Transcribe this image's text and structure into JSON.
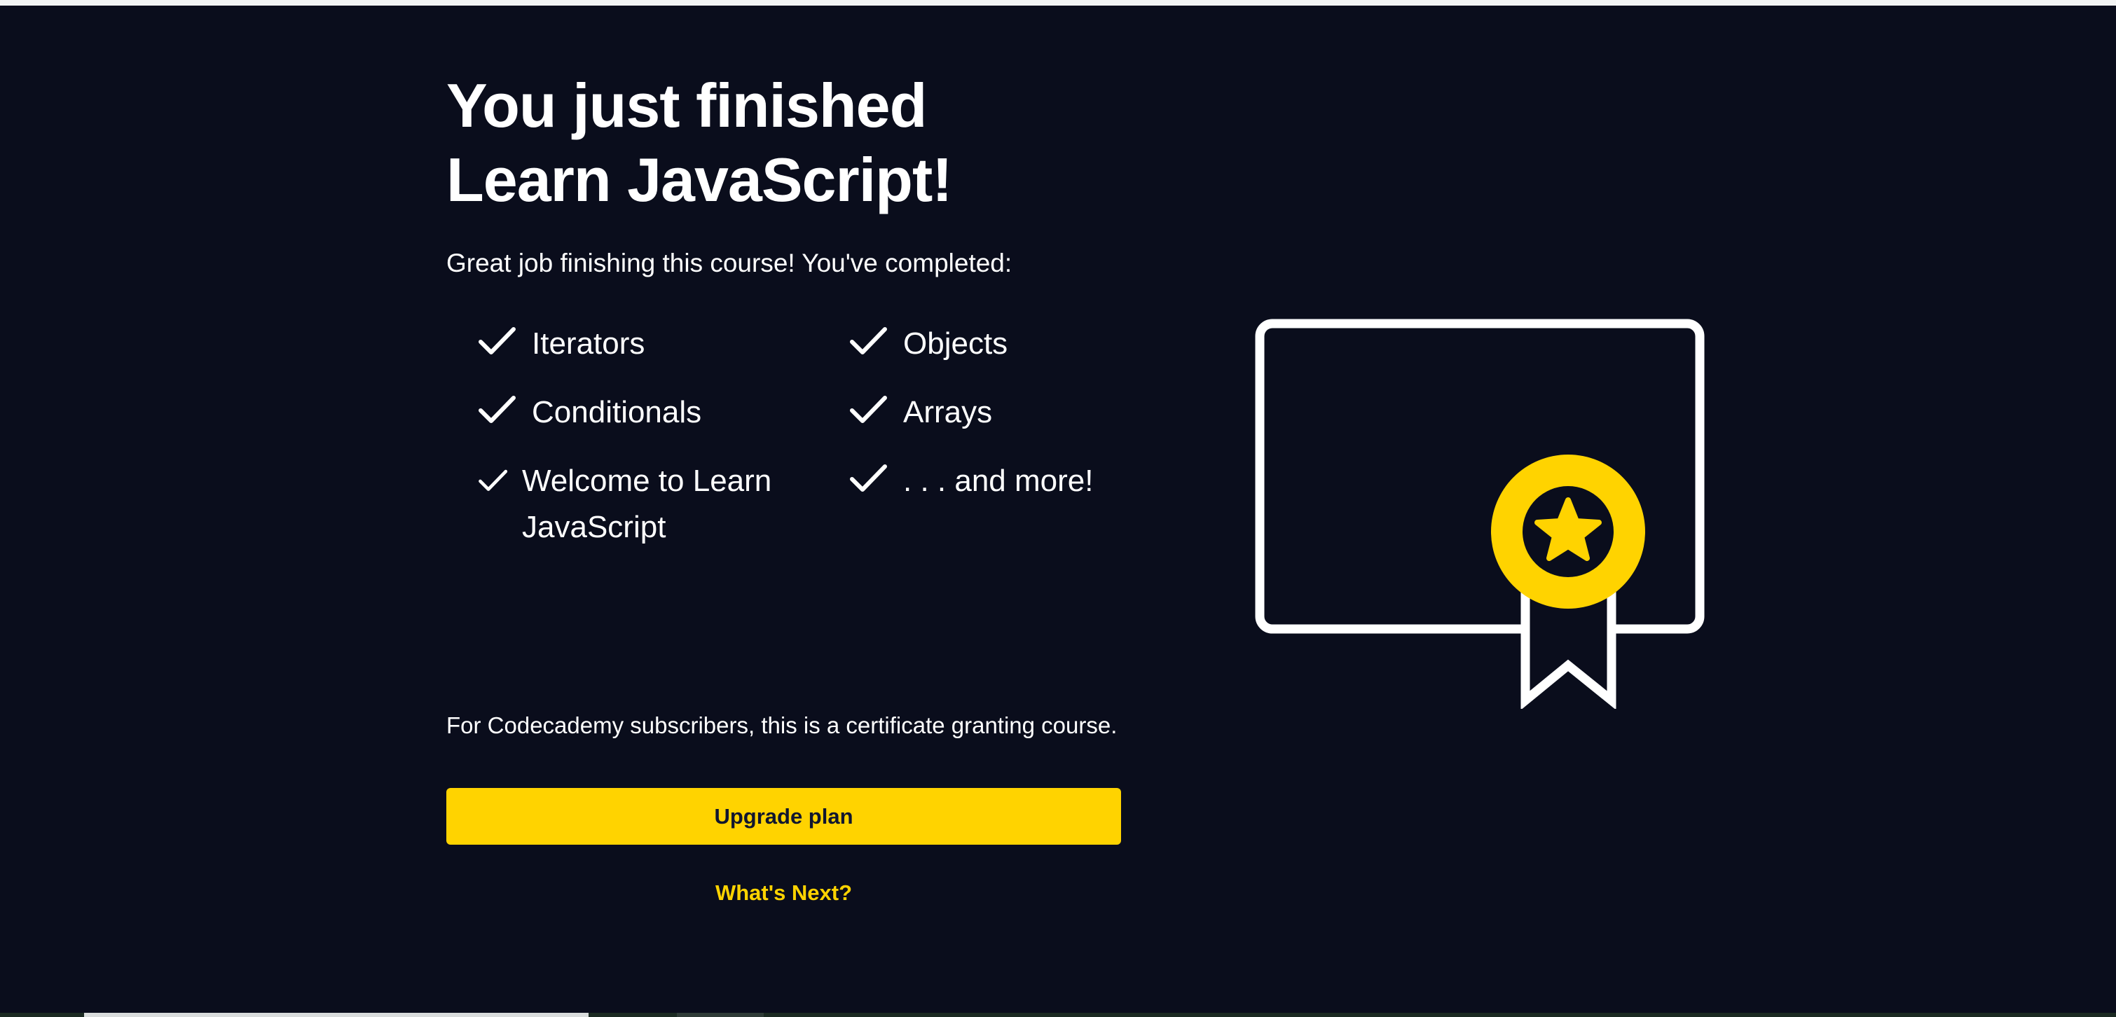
{
  "page": {
    "heading_line1": "You just finished",
    "heading_line2": "Learn JavaScript!",
    "subtitle": "Great job finishing this course! You've completed:",
    "completed_items": {
      "iterators": "Iterators",
      "objects": "Objects",
      "conditionals": "Conditionals",
      "arrays": "Arrays",
      "welcome_line1": "Welcome to Learn",
      "welcome_line2": "JavaScript",
      "more": ". . . and more!"
    },
    "subscriber_note": "For Codecademy subscribers, this is a certificate granting course.",
    "upgrade_button": "Upgrade plan",
    "whats_next_link": "What's Next?"
  },
  "colors": {
    "background": "#0a0d1c",
    "text": "#ffffff",
    "accent_yellow": "#ffd300",
    "button_text": "#10162f"
  },
  "icons": {
    "check": "checkmark-icon",
    "certificate": "certificate-icon",
    "star": "star-icon"
  }
}
